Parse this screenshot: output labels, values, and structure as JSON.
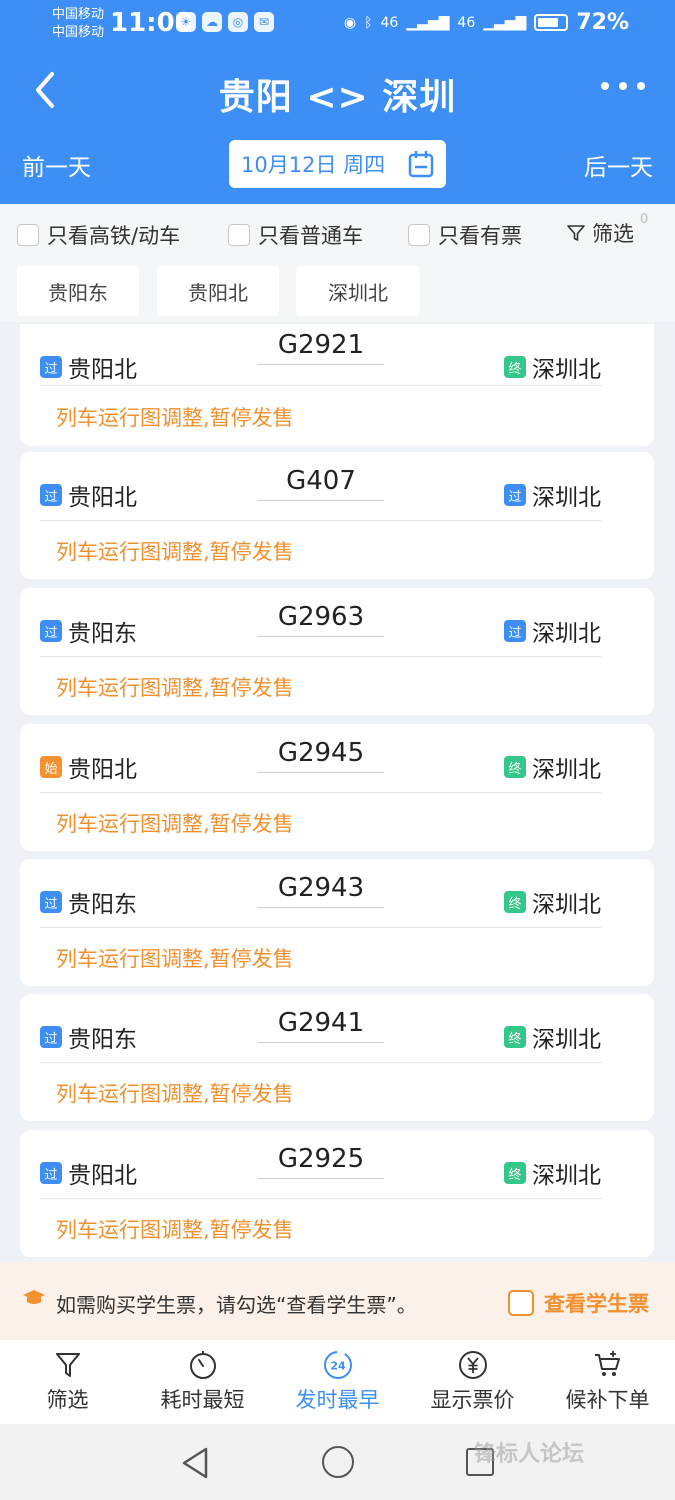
{
  "status": {
    "carrier1": "中国移动",
    "carrier2": "中国移动",
    "time": "11:00",
    "network": "46",
    "battery": "72%"
  },
  "header": {
    "title": "贵阳 <> 深圳",
    "prev_day": "前一天",
    "next_day": "后一天",
    "date": "10月12日 周四"
  },
  "filters": {
    "high_speed": "只看高铁/动车",
    "normal": "只看普通车",
    "available": "只看有票",
    "filter_label": "筛选",
    "filter_count": "0"
  },
  "stations": [
    "贵阳东",
    "贵阳北",
    "深圳北"
  ],
  "tags": {
    "pass": "过",
    "end": "终",
    "start": "始"
  },
  "trains": [
    {
      "from": "贵阳北",
      "from_tag": "过",
      "no": "G2921",
      "to": "深圳北",
      "to_tag": "终",
      "notice": "列车运行图调整,暂停发售"
    },
    {
      "from": "贵阳北",
      "from_tag": "过",
      "no": "G407",
      "to": "深圳北",
      "to_tag": "过",
      "notice": "列车运行图调整,暂停发售"
    },
    {
      "from": "贵阳东",
      "from_tag": "过",
      "no": "G2963",
      "to": "深圳北",
      "to_tag": "过",
      "notice": "列车运行图调整,暂停发售"
    },
    {
      "from": "贵阳北",
      "from_tag": "始",
      "no": "G2945",
      "to": "深圳北",
      "to_tag": "终",
      "notice": "列车运行图调整,暂停发售"
    },
    {
      "from": "贵阳东",
      "from_tag": "过",
      "no": "G2943",
      "to": "深圳北",
      "to_tag": "终",
      "notice": "列车运行图调整,暂停发售"
    },
    {
      "from": "贵阳东",
      "from_tag": "过",
      "no": "G2941",
      "to": "深圳北",
      "to_tag": "终",
      "notice": "列车运行图调整,暂停发售"
    },
    {
      "from": "贵阳北",
      "from_tag": "过",
      "no": "G2925",
      "to": "深圳北",
      "to_tag": "终",
      "notice": "列车运行图调整,暂停发售"
    }
  ],
  "student": {
    "text": "如需购买学生票，请勾选“查看学生票”。",
    "check_label": "查看学生票"
  },
  "bottom_bar": {
    "filter": "筛选",
    "shortest": "耗时最短",
    "earliest": "发时最早",
    "earliest_icon_text": "24",
    "price": "显示票价",
    "waitlist": "候补下单"
  },
  "watermark": "锋标人论坛",
  "colors": {
    "primary": "#3d8ff5",
    "notice": "#f0902e",
    "end_tag": "#35c78a",
    "start_tag": "#f5912f"
  }
}
